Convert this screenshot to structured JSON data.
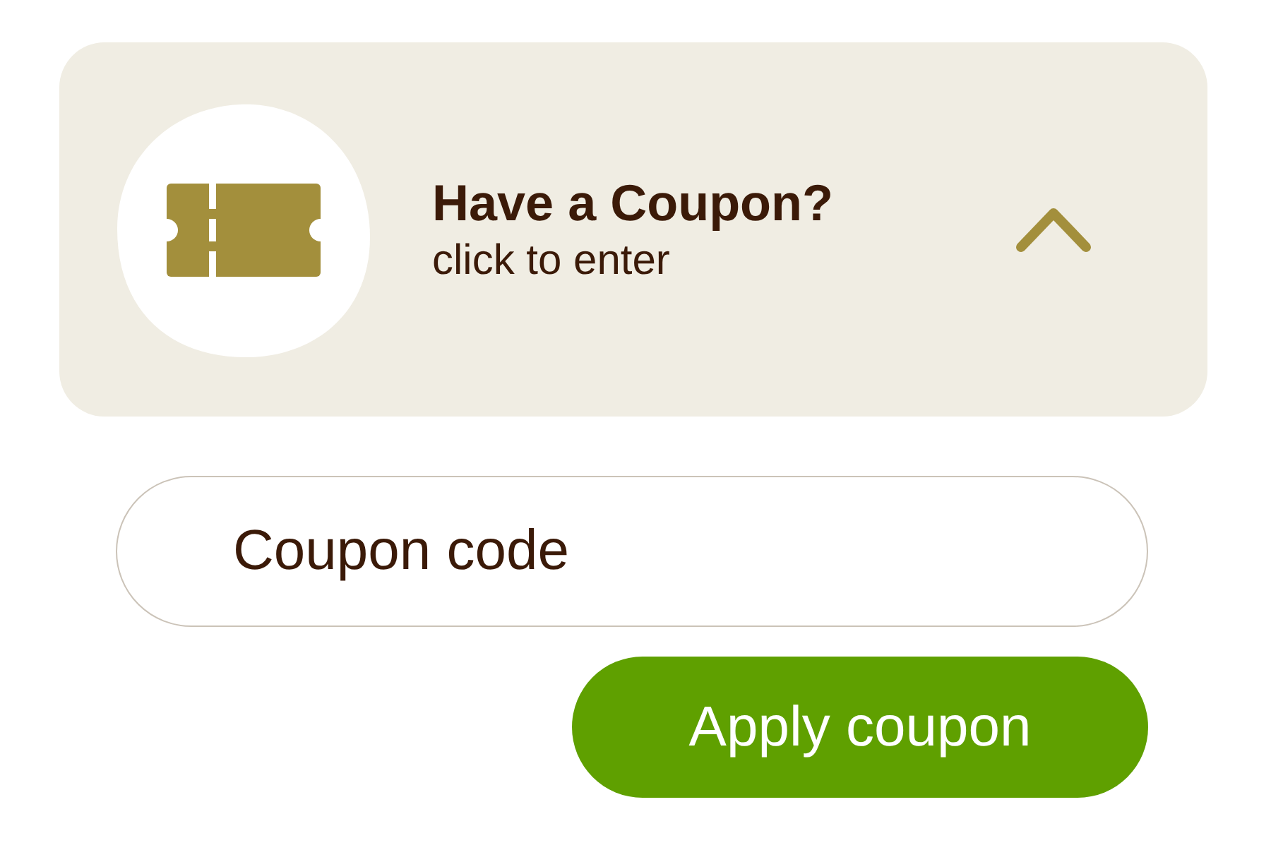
{
  "coupon_panel": {
    "title": "Have a Coupon?",
    "subtitle": "click to enter",
    "expanded": true
  },
  "coupon_field": {
    "placeholder": "Coupon code"
  },
  "apply_button": {
    "label": "Apply coupon"
  }
}
